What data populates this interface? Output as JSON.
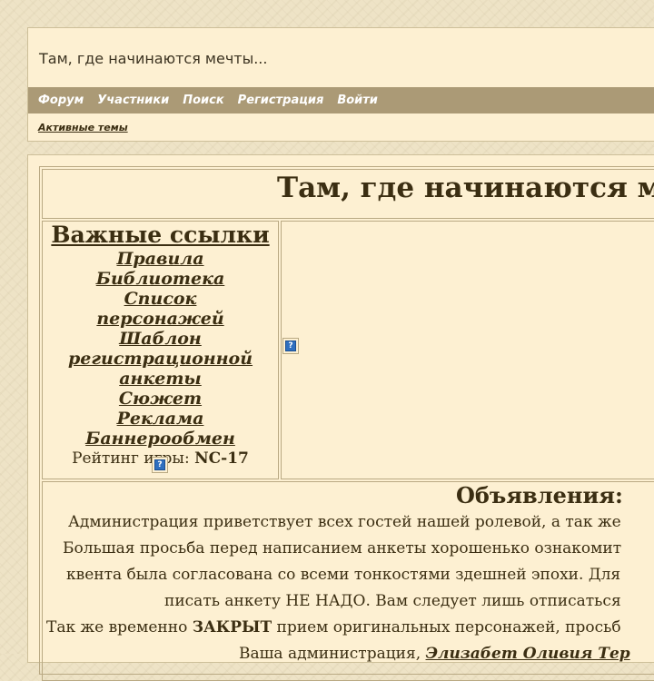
{
  "header": {
    "site_title": "Там, где начинаются мечты...",
    "nav": [
      "Форум",
      "Участники",
      "Поиск",
      "Регистрация",
      "Войти"
    ],
    "active_topics": "Активные темы"
  },
  "main": {
    "big_title": "Там, где начинаются м",
    "links": {
      "heading": "Важные ссылки",
      "items": [
        "Правила",
        "Библиотека",
        "Список персонажей",
        "Шаблон регистрационной анкеты",
        "Сюжет",
        "Реклама",
        "Баннерообмен "
      ],
      "rating_label": "Рейтинг игры:",
      "rating_value": "NC-17"
    },
    "broken_image_glyph": "?",
    "announcements": {
      "heading": "Объявления:",
      "line1": "Администрация приветствует всех гостей нашей ролевой, а так же",
      "line2": "Большая просьба перед написанием анкеты хорошенько ознакомит",
      "line3": "квента была согласована со всеми тонкостями здешней эпохи. Для",
      "line4": "писать анкету НЕ НАДО. Вам следует лишь отписаться",
      "line5_pre": "Так же временно ",
      "line5_bold": "ЗАКРЫТ",
      "line5_post": " прием оригинальных персонажей, просьб",
      "line6_pre": "Ваша администрация, ",
      "line6_sig": "Элизабет Оливия Тер"
    }
  },
  "colors": {
    "nav_bg": "#ab9a76",
    "panel_bg": "#fdf0d2",
    "text": "#3b2e12"
  }
}
